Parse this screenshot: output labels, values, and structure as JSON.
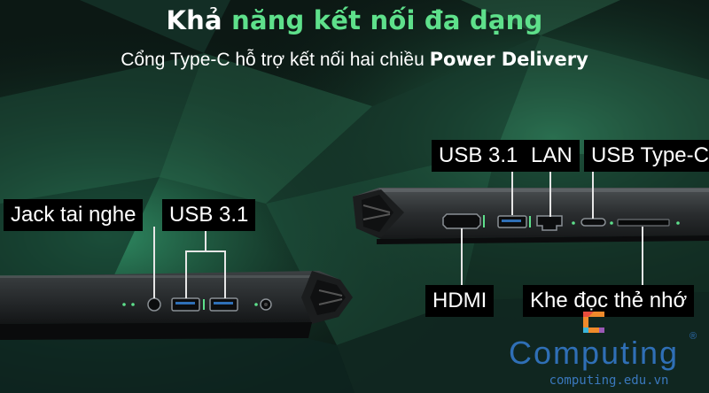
{
  "headline": {
    "white_part": "Khả",
    "accent_part": "năng kết nối đa dạng",
    "accent_color": "#5ee08b"
  },
  "subline": {
    "text": "Cổng Type-C hỗ trợ kết nối hai chiều",
    "bold": "Power Delivery"
  },
  "labels": {
    "usb31_right": "USB 3.1",
    "lan": "LAN",
    "usb_type_c": "USB Type-C",
    "jack": "Jack tai nghe",
    "usb31_left": "USB 3.1",
    "hdmi": "HDMI",
    "card_reader": "Khe đọc thẻ nhớ"
  },
  "logo": {
    "name": "Computing",
    "registered": "®",
    "site": "computing.edu.vn",
    "color": "#2f6fb6"
  }
}
